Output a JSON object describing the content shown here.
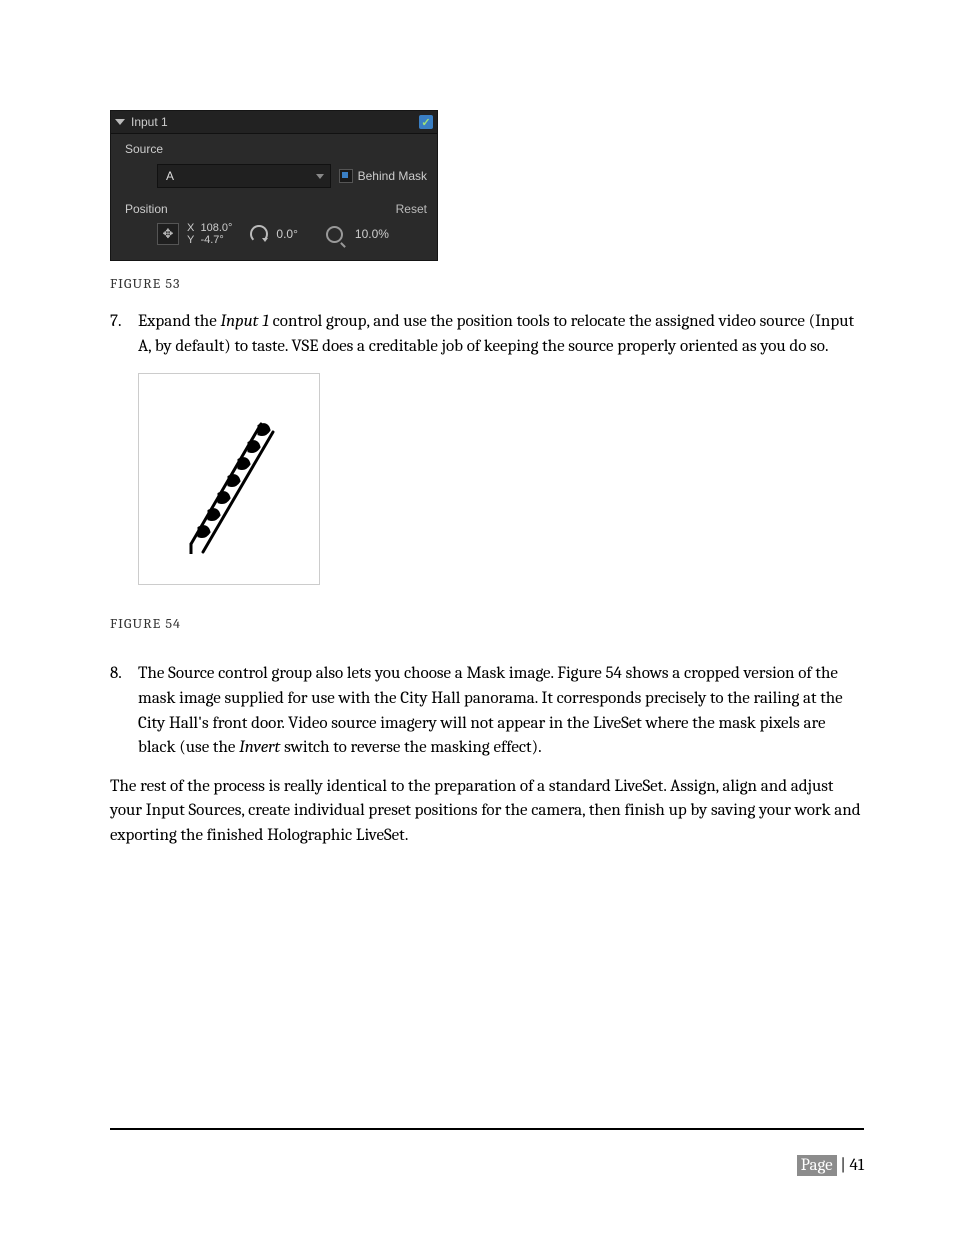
{
  "panel": {
    "title": "Input 1",
    "source_label": "Source",
    "source_value": "A",
    "behind_mask": "Behind Mask",
    "position_label": "Position",
    "reset": "Reset",
    "x_label": "X",
    "y_label": "Y",
    "x_val": "108.0°",
    "y_val": "-4.7°",
    "rot_val": "0.0°",
    "zoom_val": "10.0%"
  },
  "captions": {
    "fig53": "FIGURE 53",
    "fig54": "FIGURE 54"
  },
  "list": {
    "n7": "7.",
    "t7a": "Expand the ",
    "t7b": "Input 1",
    "t7c": " control group, and use the position tools to relocate the assigned video source (Input A, by default) to taste.  VSE does a creditable job of keeping the source properly oriented as you do so.",
    "n8": "8.",
    "t8a": "The Source control group also lets you choose a Mask image.  Figure 54 shows a cropped version of the mask image supplied for use with the City Hall panorama.  It corresponds precisely to the railing at the City Hall's front door.  Video source imagery will not appear in the LiveSet where the mask pixels are black (use the ",
    "t8b": "Invert",
    "t8c": " switch to reverse the masking effect)."
  },
  "para": "The rest of the process is really identical to the preparation of a standard LiveSet.  Assign, align and adjust your Input Sources, create individual preset positions for the camera, then finish up by saving your work and exporting the finished Holographic LiveSet.",
  "footer": {
    "label": "Page",
    "sep": " | ",
    "num": "41"
  }
}
